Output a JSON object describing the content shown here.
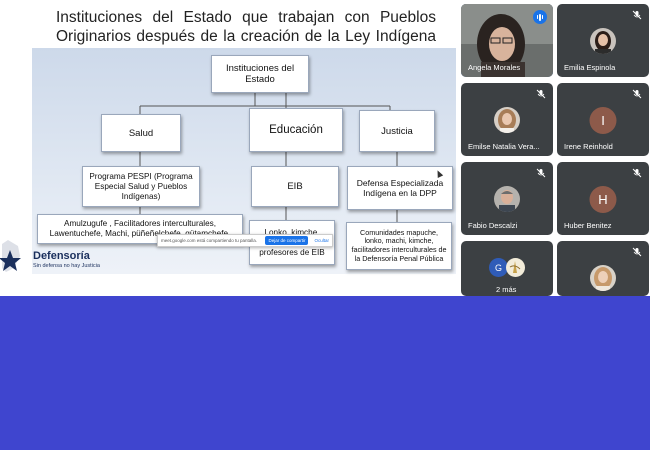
{
  "slide": {
    "title_line1": "Instituciones del Estado que trabajan con Pueblos",
    "title_line2": "Originarios después de la creación de la Ley Indígena",
    "root": "Instituciones del Estado",
    "salud": "Salud",
    "educacion": "Educación",
    "justicia": "Justicia",
    "pespi": "Programa PESPI (Programa Especial Salud y Pueblos Indígenas)",
    "eib": "EIB",
    "dpp": "Defensa Especializada Indígena en la DPP",
    "salud_leaf": "Amulzugufe , Facilitadores interculturales, Lawentuchefe, Machi, püñeñelchefe, gütamchefe.",
    "eib_leaf": "Lonko, kimche, tradicionales, profesores de EIB",
    "dpp_leaf": "Comunidades mapuche, lonko, machi, kimche, facilitadores interculturales de la Defensoría Penal Pública",
    "logo_name": "Defensoría",
    "logo_tagline": "Sin defensa no hay Justicia"
  },
  "share_bar": {
    "message": "meet.google.com está compartiendo tu pantalla.",
    "stop_label": "Dejar de compartir",
    "hide_label": "Ocultar"
  },
  "participants": [
    {
      "name": "Angela Morales",
      "speaking": true
    },
    {
      "name": "Emilia Espinola",
      "muted": true
    },
    {
      "name": "Emilse Natalia Vera...",
      "muted": true
    },
    {
      "name": "Irene Reinhold",
      "initial": "I",
      "color": "#8d5a4a",
      "muted": true
    },
    {
      "name": "Fabio Descalzi",
      "muted": true
    },
    {
      "name": "Huber Benitez",
      "initial": "H",
      "color": "#8d5a4a",
      "muted": true
    },
    {
      "name": "2 más",
      "initial": "G",
      "color": "#2f5cb8"
    },
    {
      "name": "",
      "muted": true
    }
  ],
  "colors": {
    "background": "#3f45cf",
    "tile": "#3c4043",
    "accent": "#1a73e8"
  }
}
